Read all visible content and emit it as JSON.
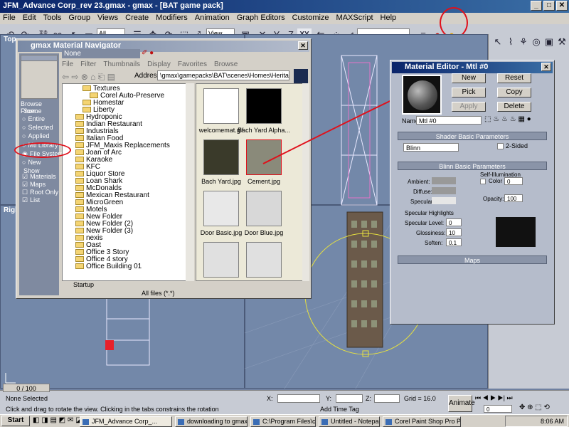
{
  "window": {
    "title": "JFM_Advance Corp_rev 23.gmax - gmax - [BAT game pack]",
    "icon": "gmax-app-icon"
  },
  "menubar": [
    "File",
    "Edit",
    "Tools",
    "Group",
    "Views",
    "Create",
    "Modifiers",
    "Animation",
    "Graph Editors",
    "Customize",
    "MAXScript",
    "Help"
  ],
  "toolbar": {
    "selection_filter": "All",
    "reference_coord": "View",
    "xy_label": "XY",
    "named_selection": ""
  },
  "viewports": {
    "top_label": "Top",
    "right_label": "Right"
  },
  "navigator": {
    "title": "gmax Material Navigator",
    "name_value": "None",
    "menu": [
      "File",
      "Filter",
      "Thumbnails",
      "Display",
      "Favorites",
      "Browse"
    ],
    "address_label": "Address:",
    "address_value": "\\gmax\\gamepacks\\BAT\\scenes\\Homes\\Heritage\\Textures\\",
    "browse_from_label": "Browse From:",
    "scene_group": "Scene",
    "scene_options": [
      "Entire",
      "Selected",
      "Applied"
    ],
    "source_options": [
      "Mtl Library",
      "File System",
      "New"
    ],
    "show_group": "Show",
    "show_options": [
      "Materials",
      "Maps",
      "Root Only",
      "List"
    ],
    "tree": [
      {
        "label": "Textures",
        "indent": 2
      },
      {
        "label": "Corel Auto-Preserve",
        "indent": 3
      },
      {
        "label": "Homestar",
        "indent": 2
      },
      {
        "label": "Liberty",
        "indent": 2
      },
      {
        "label": "Hydroponic",
        "indent": 1
      },
      {
        "label": "Indian Restaurant",
        "indent": 1
      },
      {
        "label": "Industrials",
        "indent": 1
      },
      {
        "label": "Italian Food",
        "indent": 1
      },
      {
        "label": "JFM_Maxis Replacements",
        "indent": 1
      },
      {
        "label": "Joan of Arc",
        "indent": 1
      },
      {
        "label": "Karaoke",
        "indent": 1
      },
      {
        "label": "KFC",
        "indent": 1
      },
      {
        "label": "Liquor Store",
        "indent": 1
      },
      {
        "label": "Loan Shark",
        "indent": 1
      },
      {
        "label": "McDonalds",
        "indent": 1
      },
      {
        "label": "Mexican Restaurant",
        "indent": 1
      },
      {
        "label": "MicroGreen",
        "indent": 1
      },
      {
        "label": "Motels",
        "indent": 1
      },
      {
        "label": "New Folder",
        "indent": 1
      },
      {
        "label": "New Folder (2)",
        "indent": 1
      },
      {
        "label": "New Folder (3)",
        "indent": 1
      },
      {
        "label": "nexis",
        "indent": 1
      },
      {
        "label": "Oast",
        "indent": 1
      },
      {
        "label": "Office 3 Story",
        "indent": 1
      },
      {
        "label": "Office 4 story",
        "indent": 1
      },
      {
        "label": "Office Building 01",
        "indent": 1
      }
    ],
    "thumbnails": [
      "welcomemat.gif",
      "Bach Yard Alpha...",
      "Bach Yard.jpg",
      "Cement.jpg",
      "Door Basic.jpg",
      "Door Blue.jpg",
      "",
      ""
    ],
    "startup_label": "Startup",
    "files_filter": "All files (*.*)"
  },
  "material_editor": {
    "title": "Material Editor - Mtl #0",
    "buttons": {
      "new": "New",
      "pick": "Pick",
      "apply": "Apply",
      "reset": "Reset",
      "copy": "Copy",
      "delete": "Delete"
    },
    "name_label": "Name",
    "name_value": "Mtl #0",
    "shader_rollout": "Shader Basic Parameters",
    "shader_value": "Blinn",
    "two_sided": "2-Sided",
    "blinn_rollout": "Blinn Basic Parameters",
    "self_illum": "Self-Illumination",
    "color_label": "Color",
    "color_value": "0",
    "ambient": "Ambient:",
    "diffuse": "Diffuse:",
    "specular": "Specular:",
    "opacity_label": "Opacity:",
    "opacity_value": "100",
    "spec_highlights": "Specular Highlights",
    "spec_level_label": "Specular Level:",
    "spec_level_value": "0",
    "glossiness_label": "Glossiness:",
    "glossiness_value": "10",
    "soften_label": "Soften:",
    "soften_value": "0.1",
    "maps_rollout": "Maps"
  },
  "status": {
    "frame": "0 / 100",
    "selection": "None Selected",
    "prompt": "Click and drag to rotate the view.  Clicking in the tabs constrains the rotation",
    "x_label": "X:",
    "y_label": "Y:",
    "z_label": "Z:",
    "grid": "Grid = 16.0",
    "add_time_tag": "Add Time Tag",
    "animate": "Animate",
    "frame_spinner": "0"
  },
  "taskbar": {
    "start": "Start",
    "tasks": [
      "JFM_Advance Corp_...",
      "downloading to gmax -...",
      "C:\\Program Files\\clip2pic",
      "Untitled - Notepad",
      "Corel Paint Shop Pro Ph..."
    ],
    "clock": "8:06 AM"
  },
  "colors": {
    "annotation": "#e0101a",
    "viewport": "#7388a9",
    "title_active": "#0a246a"
  }
}
